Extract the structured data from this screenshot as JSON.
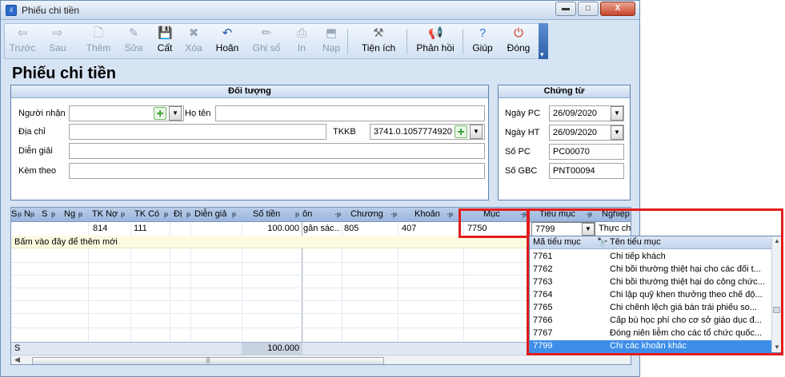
{
  "window": {
    "title": "Phiếu chi tiền",
    "close_glyph": "X",
    "min_glyph": "▬",
    "max_glyph": "□"
  },
  "toolbar": {
    "prev": "Trước",
    "next": "Sau",
    "add": "Thêm",
    "edit": "Sửa",
    "save": "Cất",
    "delete": "Xóa",
    "undo": "Hoãn",
    "post": "Ghi sổ",
    "print": "In",
    "load": "Nạp",
    "utilities": "Tiện ích",
    "feedback": "Phản hồi",
    "help": "Giúp",
    "close": "Đóng"
  },
  "form": {
    "title": "Phiếu chi tiền"
  },
  "doi_tuong": {
    "heading": "Đối tượng",
    "nguoi_nhan_label": "Người nhận",
    "nguoi_nhan_value": "",
    "ho_ten_label": "Họ tên",
    "ho_ten_value": "",
    "dia_chi_label": "Địa chỉ",
    "dia_chi_value": "",
    "tkkb_label": "TKKB",
    "tkkb_value": "3741.0.1057774920",
    "dien_giai_label": "Diễn giải",
    "dien_giai_value": "",
    "kem_theo_label": "Kèm theo",
    "kem_theo_value": ""
  },
  "chung_tu": {
    "heading": "Chứng từ",
    "ngay_pc_label": "Ngày PC",
    "ngay_pc_value": "26/09/2020",
    "ngay_ht_label": "Ngày HT",
    "ngay_ht_value": "26/09/2020",
    "so_pc_label": "Số PC",
    "so_pc_value": "PC00070",
    "so_gbc_label": "Số GBC",
    "so_gbc_value": "PNT00094"
  },
  "grid": {
    "columns": [
      "S",
      "N",
      "S",
      "Ng",
      "TK Nợ",
      "TK Có",
      "Đị",
      "Diễn giả",
      "Số tiền",
      "ôn",
      "Chương",
      "Khoản",
      "Mục",
      "Tiểu mục",
      "Nghiệp"
    ],
    "row": {
      "tk_no": "814",
      "tk_co": "111",
      "so_tien": "100.000",
      "nguon": "gân sác...",
      "chuong": "805",
      "khoan": "407",
      "muc": "7750",
      "tieu_muc": "7799",
      "nghiep": "Thực ch"
    },
    "add_new_text": "Bấm vào đây để thêm mới",
    "footer_label": "S",
    "footer_total": "100.000"
  },
  "dropdown": {
    "col1": "Mã tiểu mục",
    "col2": "Tên tiểu mục",
    "rows": [
      {
        "code": "7761",
        "name": "Chi tiếp khách"
      },
      {
        "code": "7762",
        "name": "Chi bồi thường thiệt hại cho các đối t..."
      },
      {
        "code": "7763",
        "name": "Chi bồi thường thiệt hại do công chức..."
      },
      {
        "code": "7764",
        "name": "Chi lập quỹ khen thưởng theo chế độ..."
      },
      {
        "code": "7765",
        "name": "Chi chênh lệch giá bán trái phiếu so..."
      },
      {
        "code": "7766",
        "name": "Cấp bù học phí cho cơ sở giáo dục đ..."
      },
      {
        "code": "7767",
        "name": "Đóng niên liễm cho các tổ chức quốc..."
      },
      {
        "code": "7799",
        "name": "Chi các khoản khác"
      }
    ],
    "selected_code": "7799"
  },
  "colors": {
    "highlight": "#e21c1c",
    "selected_row": "#3d8ee8",
    "header_blue": "#9bb7dd"
  }
}
